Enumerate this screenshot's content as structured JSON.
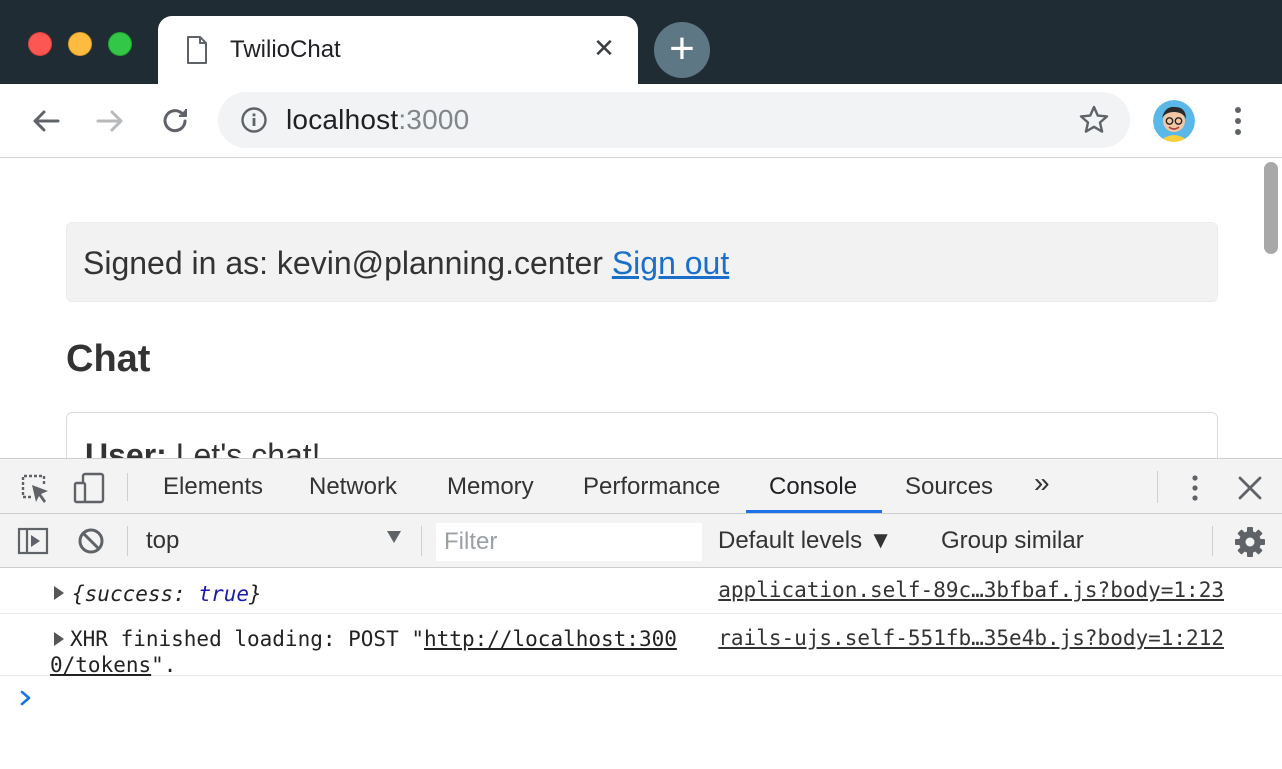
{
  "browser": {
    "tab_title": "TwilioChat",
    "tab_close_glyph": "✕",
    "new_tab_glyph": "+",
    "url_host": "localhost",
    "url_port": ":3000",
    "icons": {
      "back": "back-arrow-icon",
      "forward": "forward-arrow-icon",
      "reload": "reload-icon",
      "info": "info-icon",
      "bookmark": "star-icon",
      "menu": "vertical-dots-icon"
    },
    "colors": {
      "titlebar": "#202c33",
      "new_tab_button": "#5e7785"
    }
  },
  "page": {
    "signed_in_prefix": "Signed in as: kevin@planning.center",
    "sign_out_link": "Sign out",
    "heading": "Chat",
    "messages": [
      {
        "user": "User:",
        "text": "Let's chat!"
      }
    ],
    "link_color": "#1a6fcb"
  },
  "devtools": {
    "tabs": [
      "Elements",
      "Network",
      "Memory",
      "Performance",
      "Console",
      "Sources"
    ],
    "active_tab": "Console",
    "more_tabs_glyph": "»",
    "close_glyph": "✕",
    "context": "top",
    "filter_placeholder": "Filter",
    "levels_label": "Default levels ▼",
    "group_similar_label": "Group similar",
    "console_messages": [
      {
        "open": "{",
        "key": "success",
        "sep": ": ",
        "value": "true",
        "close": "}",
        "source": "application.self-89c…3bfbaf.js?body=1:23"
      },
      {
        "prefix": "XHR finished loading: POST \"",
        "url": "http://localhost:3000/tokens",
        "suffix": "\".",
        "source": "rails-ujs.self-551fb…35e4b.js?body=1:212"
      }
    ],
    "active_color": "#1a73e8"
  }
}
